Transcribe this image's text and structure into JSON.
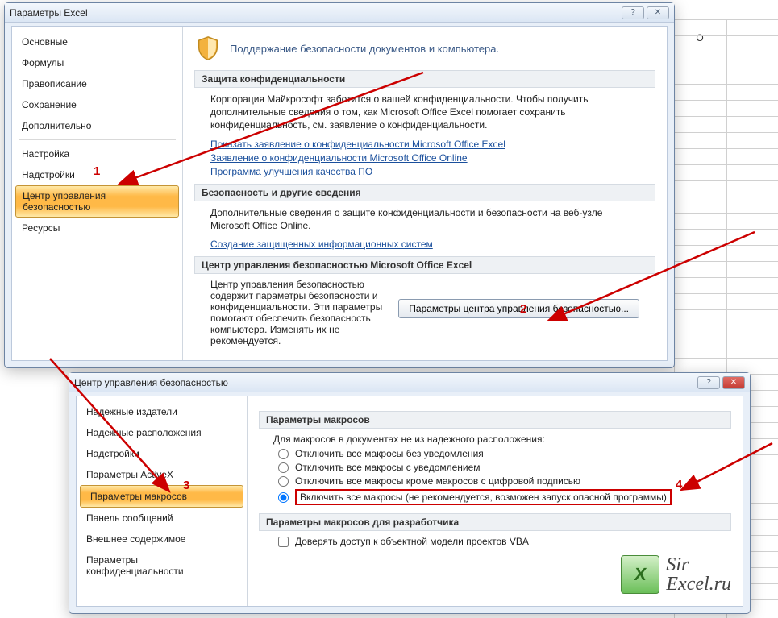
{
  "sheet": {
    "col1": "O"
  },
  "dialog1": {
    "title": "Параметры Excel",
    "nav": [
      "Основные",
      "Формулы",
      "Правописание",
      "Сохранение",
      "Дополнительно",
      "Настройка",
      "Надстройки",
      "Центр управления безопасностью",
      "Ресурсы"
    ],
    "header_main": "Поддержание безопасности документов и компьютера.",
    "sec_privacy": "Защита конфиденциальности",
    "privacy_text": "Корпорация Майкрософт заботится о вашей конфиденциальности. Чтобы получить дополнительные сведения о том, как Microsoft Office Excel помогает сохранить конфиденциальность, см. заявление о конфиденциальности.",
    "links": [
      "Показать заявление о конфиденциальности Microsoft Office Excel",
      "Заявление о конфиденциальности Microsoft Office Online",
      "Программа улучшения качества ПО"
    ],
    "sec_security": "Безопасность и другие сведения",
    "security_text": "Дополнительные сведения о защите конфиденциальности и безопасности на веб-узле Microsoft Office Online.",
    "link_security": "Создание защищенных информационных систем",
    "sec_trust": "Центр управления безопасностью Microsoft Office Excel",
    "trust_text": "Центр управления безопасностью содержит параметры безопасности и конфиденциальности. Эти параметры помогают обеспечить безопасность компьютера. Изменять их не рекомендуется.",
    "trust_button": "Параметры центра управления безопасностью..."
  },
  "dialog2": {
    "title": "Центр управления безопасностью",
    "nav": [
      "Надежные издатели",
      "Надежные расположения",
      "Надстройки",
      "Параметры ActiveX",
      "Параметры макросов",
      "Панель сообщений",
      "Внешнее содержимое",
      "Параметры конфиденциальности"
    ],
    "sec_macros": "Параметры макросов",
    "macros_intro": "Для макросов в документах не из надежного расположения:",
    "radios": [
      "Отключить все макросы без уведомления",
      "Отключить все макросы с уведомлением",
      "Отключить все макросы кроме макросов с цифровой подписью",
      "Включить все макросы (не рекомендуется, возможен запуск опасной программы)"
    ],
    "sec_dev": "Параметры макросов для разработчика",
    "chk_dev": "Доверять доступ к объектной модели проектов VBA"
  },
  "annotations": {
    "n1": "1",
    "n2": "2",
    "n3": "3",
    "n4": "4"
  },
  "watermark": {
    "line1": "Sir",
    "line2": "Excel.ru"
  }
}
